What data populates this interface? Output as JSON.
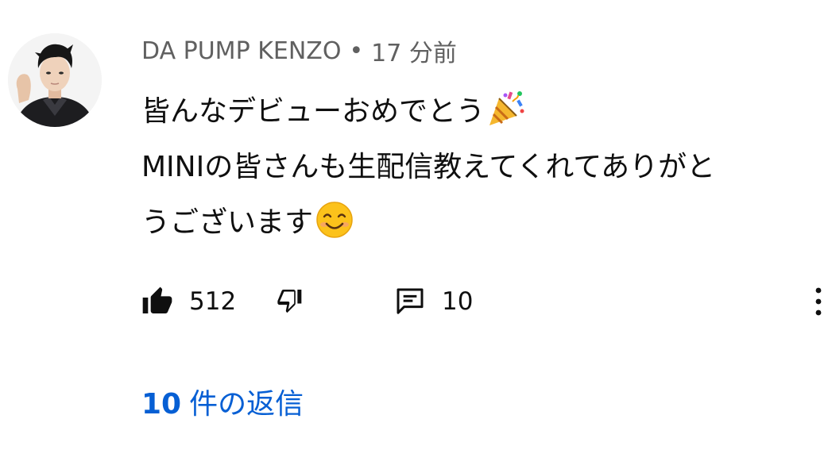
{
  "comment": {
    "author": "DA PUMP KENZO",
    "separator": "•",
    "time": "17 分前",
    "lines": [
      "皆んなデビューおめでとう",
      "MINIの皆さんも生配信教えてくれてありがと",
      "うございます"
    ],
    "emojis": {
      "line1_end": "party-popper",
      "line3_end": "smiling-face"
    },
    "like_count": "512",
    "reply_count": "10",
    "replies_link": {
      "count": "10",
      "label": "件の返信"
    },
    "colors": {
      "link": "#065fd4",
      "meta": "#606060",
      "text": "#0f0f0f"
    }
  }
}
